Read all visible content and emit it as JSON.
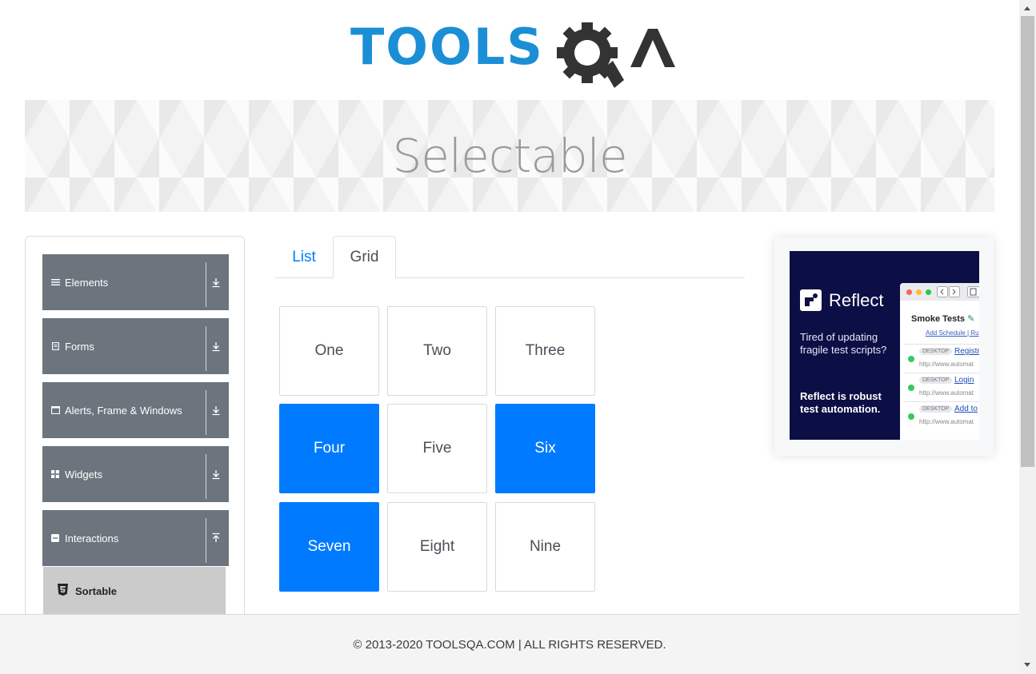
{
  "logo": {
    "tools_text": "TOOLS",
    "qa_text": "QA",
    "primary_color": "#1b8fd6",
    "secondary_color": "#333333"
  },
  "page": {
    "title": "Selectable"
  },
  "sidebar": {
    "groups": [
      {
        "label": "Elements",
        "icon": "hamburger-icon",
        "state": "collapsed"
      },
      {
        "label": "Forms",
        "icon": "form-icon",
        "state": "collapsed"
      },
      {
        "label": "Alerts, Frame & Windows",
        "icon": "window-icon",
        "state": "collapsed"
      },
      {
        "label": "Widgets",
        "icon": "grid-icon",
        "state": "collapsed"
      },
      {
        "label": "Interactions",
        "icon": "interaction-icon",
        "state": "expanded"
      }
    ],
    "subitems": [
      {
        "label": "Sortable",
        "icon": "html5-icon"
      }
    ]
  },
  "tabs": [
    {
      "label": "List",
      "active": false
    },
    {
      "label": "Grid",
      "active": true
    }
  ],
  "grid": {
    "cells": [
      {
        "label": "One",
        "selected": false
      },
      {
        "label": "Two",
        "selected": false
      },
      {
        "label": "Three",
        "selected": false
      },
      {
        "label": "Four",
        "selected": true
      },
      {
        "label": "Five",
        "selected": false
      },
      {
        "label": "Six",
        "selected": true
      },
      {
        "label": "Seven",
        "selected": true
      },
      {
        "label": "Eight",
        "selected": false
      },
      {
        "label": "Nine",
        "selected": false
      }
    ],
    "selected_color": "#007bff"
  },
  "ad": {
    "brand": "Reflect",
    "tagline": "Tired of updating fragile test scripts?",
    "pitch": "Reflect is robust test automation.",
    "window": {
      "title": "Smoke Tests",
      "subtitle": "Add Schedule  |  Ru",
      "rows": [
        {
          "tag": "DESKTOP",
          "link": "Registr",
          "url": "http://www.automat"
        },
        {
          "tag": "DESKTOP",
          "link": "Login",
          "url": "http://www.automat"
        },
        {
          "tag": "DESKTOP",
          "link": "Add to",
          "url": "http://www.automat"
        }
      ]
    }
  },
  "footer": {
    "text": "© 2013-2020 TOOLSQA.COM | ALL RIGHTS RESERVED."
  }
}
